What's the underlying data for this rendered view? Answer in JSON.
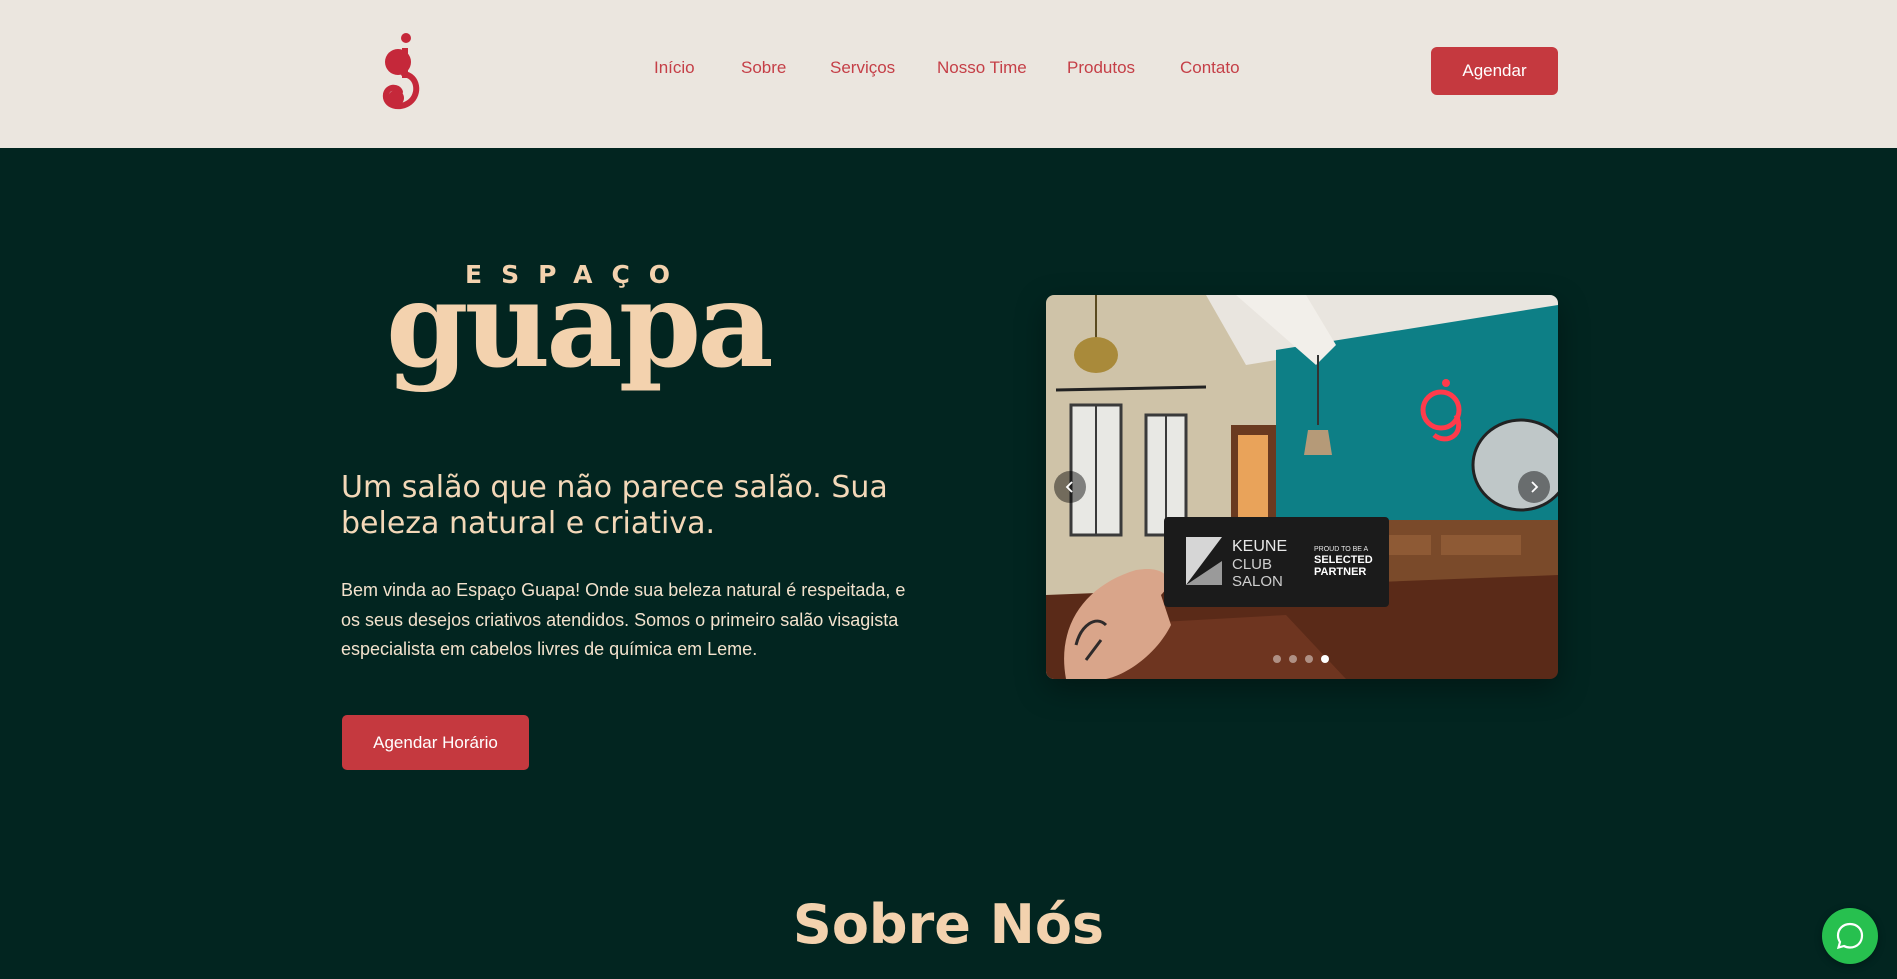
{
  "header": {
    "logo_icon": "g-monogram-logo",
    "nav": [
      {
        "label": "Início"
      },
      {
        "label": "Sobre"
      },
      {
        "label": "Serviços"
      },
      {
        "label": "Nosso Time"
      },
      {
        "label": "Produtos"
      },
      {
        "label": "Contato"
      }
    ],
    "cta_label": "Agendar"
  },
  "hero": {
    "brand_small": "ESPAÇO",
    "brand_big": "guapa",
    "headline": "Um salão que não parece salão. Sua beleza natural e criativa.",
    "intro": "Bem vinda ao Espaço Guapa! Onde sua beleza natural é respeitada, e os seus desejos criativos atendidos. Somos o primeiro salão visagista especialista em cabelos livres de química em Leme.",
    "cta_label": "Agendar Horário",
    "carousel": {
      "slide_count": 4,
      "active_slide": 4,
      "card": {
        "brand": "KEUNE",
        "line1": "CLUB",
        "line2": "SALON",
        "tag_small": "PROUD TO BE A",
        "tag_big1": "SELECTED",
        "tag_big2": "PARTNER"
      },
      "prev_icon": "chevron-left-icon",
      "next_icon": "chevron-right-icon"
    }
  },
  "about": {
    "title": "Sobre Nós"
  },
  "whatsapp": {
    "icon": "whatsapp-icon"
  },
  "colors": {
    "header_bg": "#ebe6df",
    "hero_bg": "#022520",
    "accent_red": "#c5393f",
    "cream": "#f3d2ae",
    "whatsapp_green": "#27c04f"
  }
}
